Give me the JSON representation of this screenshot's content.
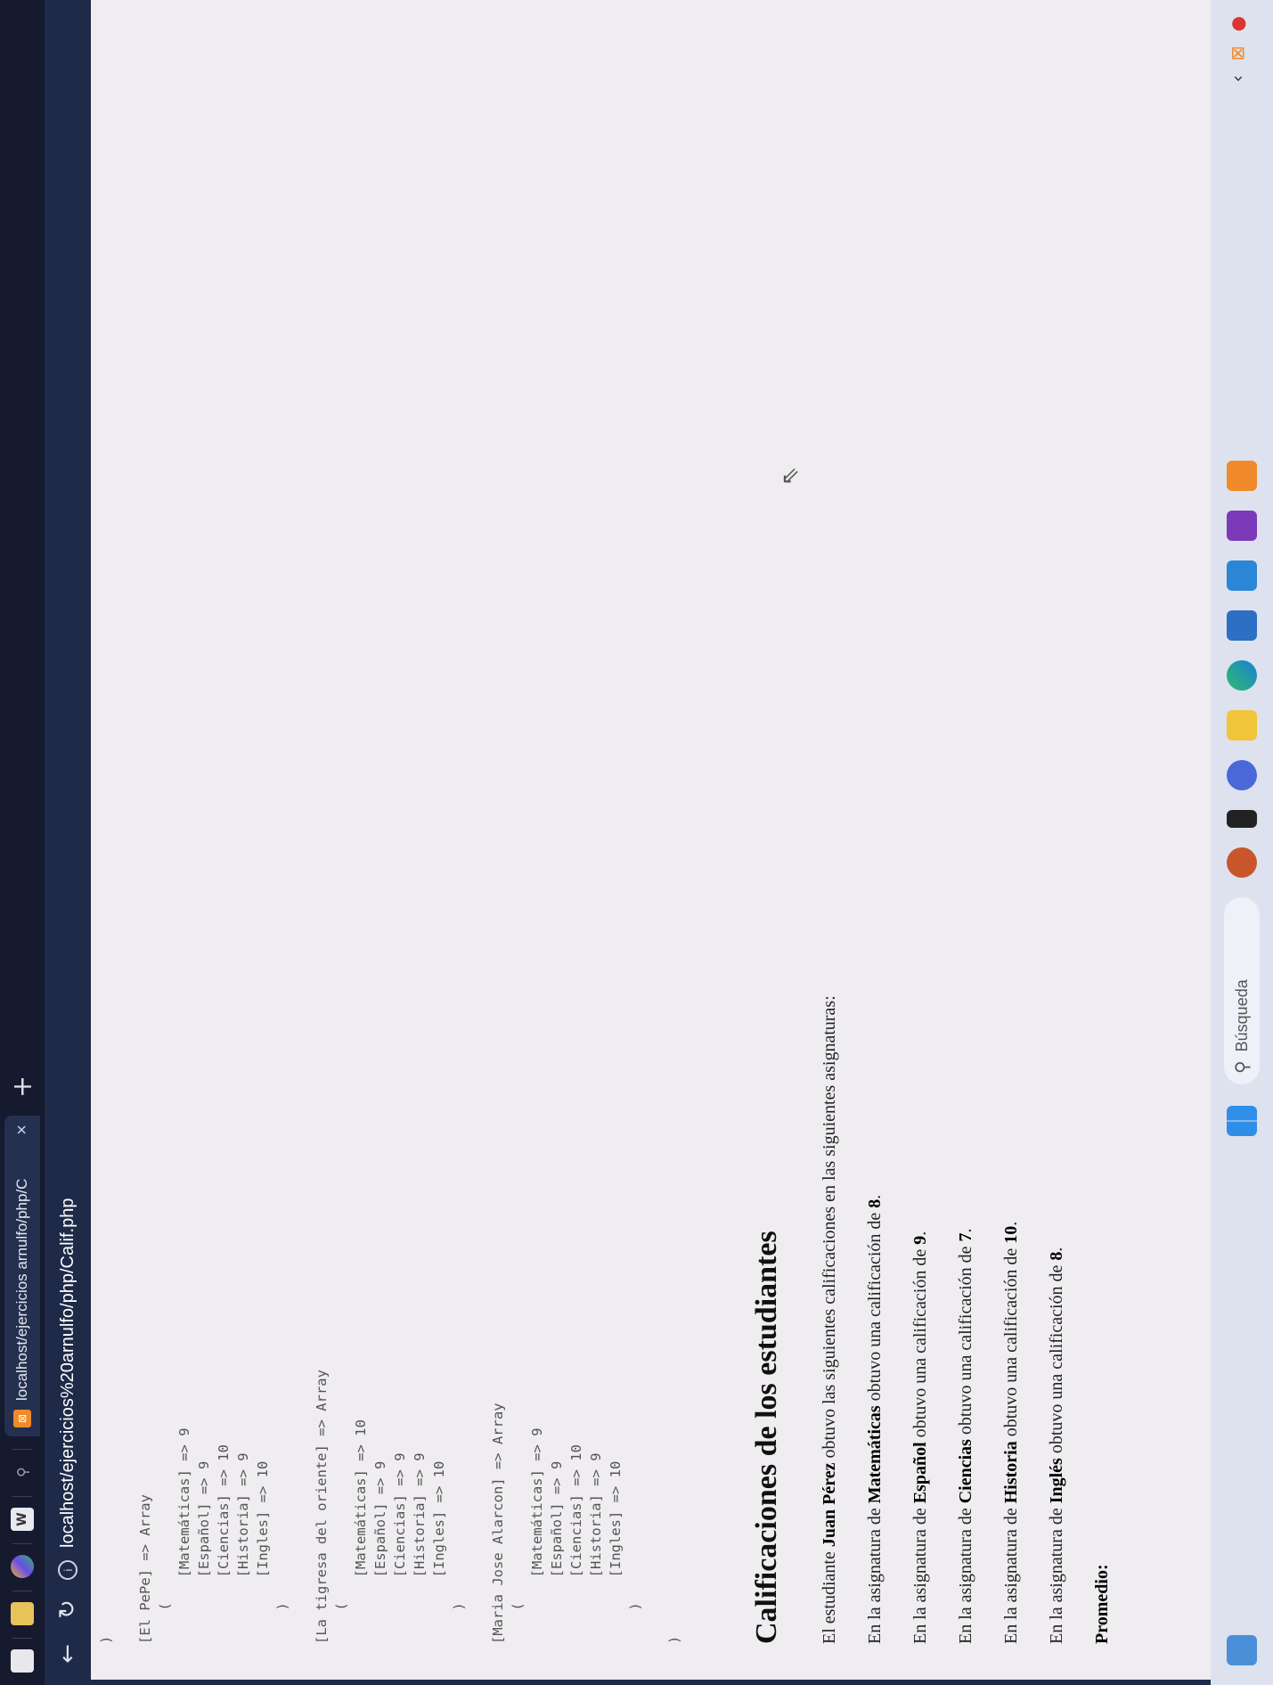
{
  "browser": {
    "tab_title": "localhost/ejercicios arnulfo/php/C",
    "url": "localhost/ejercicios%20arnulfo/php/Calif.php"
  },
  "page": {
    "array_dump": ")\n\n[El PePe] => Array\n    (\n        [Matemáticas] => 9\n        [Español] => 9\n        [Ciencias] => 10\n        [Historia] => 9\n        [Ingles] => 10\n    )\n\n[La tigresa del oriente] => Array\n    (\n        [Matemáticas] => 10\n        [Español] => 9\n        [Ciencias] => 9\n        [Historia] => 9\n        [Ingles] => 10\n    )\n\n[Maria Jose Alarcon] => Array\n    (\n        [Matemáticas] => 9\n        [Español] => 9\n        [Ciencias] => 10\n        [Historia] => 9\n        [Ingles] => 10\n    )\n\n)",
    "heading": "Calificaciones de los estudiantes",
    "intro": {
      "prefix": "El estudiante ",
      "student": "Juan Pérez",
      "suffix": " obtuvo las siguientes calificaciones en las siguientes asignaturas:"
    },
    "grades": [
      {
        "prefix": "En la asignatura de ",
        "subject": "Matemáticas",
        "middle": " obtuvo una calificación de ",
        "grade": "8",
        "end": "."
      },
      {
        "prefix": "En la asignatura de ",
        "subject": "Español",
        "middle": " obtuvo una calificación de ",
        "grade": "9",
        "end": "."
      },
      {
        "prefix": "En la asignatura de ",
        "subject": "Ciencias",
        "middle": " obtuvo una calificación de ",
        "grade": "7",
        "end": "."
      },
      {
        "prefix": "En la asignatura de ",
        "subject": "Historia",
        "middle": " obtuvo una calificación de ",
        "grade": "10",
        "end": "."
      },
      {
        "prefix": "En la asignatura de ",
        "subject": "Inglés",
        "middle": " obtuvo una calificación de ",
        "grade": "8",
        "end": "."
      }
    ],
    "average_label": "Promedio:"
  },
  "taskbar": {
    "search_placeholder": "Búsqueda"
  },
  "colors": {
    "titlebar": "#151a2e",
    "addressbar": "#1e2a48",
    "page_bg": "#efedf0",
    "taskbar": "#dde2ee"
  }
}
